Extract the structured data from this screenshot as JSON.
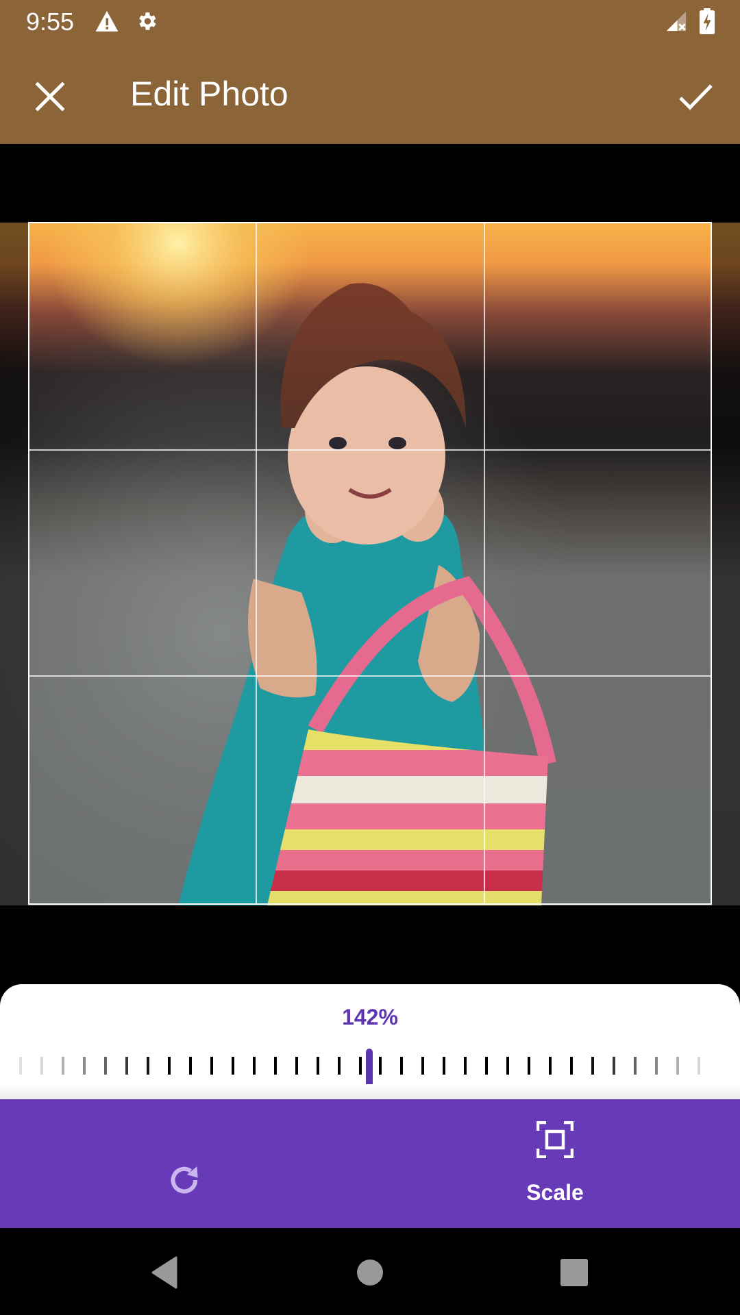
{
  "status_bar": {
    "time": "9:55",
    "left_icons": [
      "warning-icon",
      "settings-gear-icon"
    ],
    "right_icons": [
      "signal-no-service-icon",
      "battery-charging-icon"
    ]
  },
  "app_bar": {
    "title": "Edit Photo",
    "close_icon": "close-icon",
    "confirm_icon": "check-icon",
    "background_color": "#8B6438"
  },
  "editor": {
    "photo_description": "Little girl in teal dress holding striped pink and yellow bag at sunset",
    "crop_grid": "rule-of-thirds"
  },
  "scale_control": {
    "value_label": "142%",
    "value_percent": 142,
    "accent_color": "#5E35B1"
  },
  "toolbar": {
    "background_color": "#673AB7",
    "tools": [
      {
        "icon": "rotate-icon",
        "label": "",
        "active": false
      },
      {
        "icon": "scale-icon",
        "label": "Scale",
        "active": true
      }
    ]
  },
  "nav_bar": {
    "buttons": [
      "back-icon",
      "home-icon",
      "recents-icon"
    ]
  }
}
